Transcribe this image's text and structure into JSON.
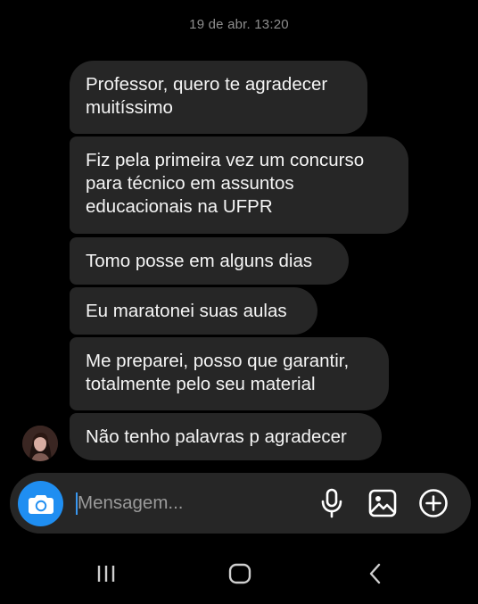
{
  "conversation": {
    "timestamp": "19 de abr. 13:20",
    "messages": [
      {
        "text": "Professor, quero te agradecer\nmuitíssimo"
      },
      {
        "text": "Fiz pela primeira vez um concurso\npara técnico em assuntos\neducacionais na UFPR"
      },
      {
        "text": "Tomo posse em alguns dias"
      },
      {
        "text": "Eu maratonei suas aulas"
      },
      {
        "text": "Me preparei, posso que garantir,\ntotalmente pelo seu material"
      },
      {
        "text": "Não tenho palavras p agradecer"
      }
    ]
  },
  "composer": {
    "placeholder": "Mensagem...",
    "value": "",
    "icons": {
      "camera": "camera-icon",
      "mic": "microphone-icon",
      "gallery": "gallery-icon",
      "plus": "plus-icon"
    }
  },
  "navbar": {
    "icons": [
      "recents-icon",
      "home-icon",
      "back-icon"
    ]
  },
  "colors": {
    "background": "#000000",
    "bubble": "#262626",
    "accent": "#1f8ef1",
    "timestamp": "#8e8e8e",
    "placeholder": "#9a9a9a"
  }
}
